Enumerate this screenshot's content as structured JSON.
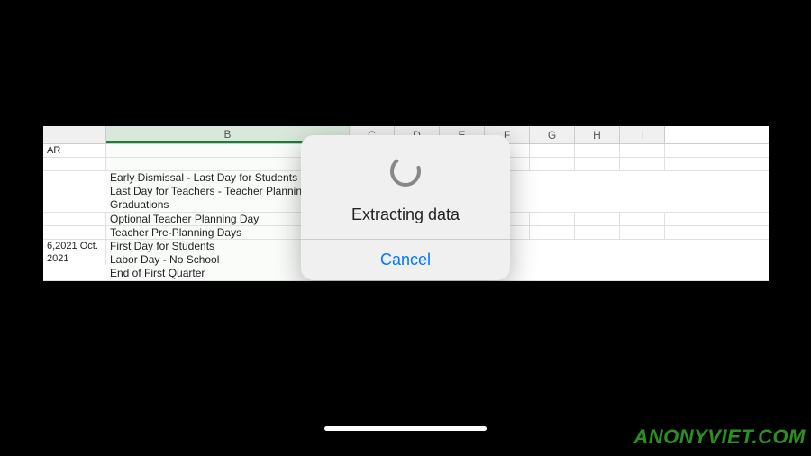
{
  "columns": [
    "",
    "B",
    "C",
    "D",
    "E",
    "F",
    "G",
    "H",
    "I"
  ],
  "colA": {
    "r0": "AR",
    "r5": "6,2021 Oct.\n2021"
  },
  "colB": {
    "r2": "Early Dismissal - Last Day for Students\nLast Day for Teachers - Teacher Plannin\nGraduations",
    "r3": "Optional Teacher Planning Day",
    "r4": "Teacher Pre-Planning Days",
    "r5": "First Day for Students\nLabor Day - No School\nEnd of First Quarter"
  },
  "modal": {
    "title": "Extracting data",
    "cancel": "Cancel"
  },
  "watermark": "ANONYVIET.COM"
}
